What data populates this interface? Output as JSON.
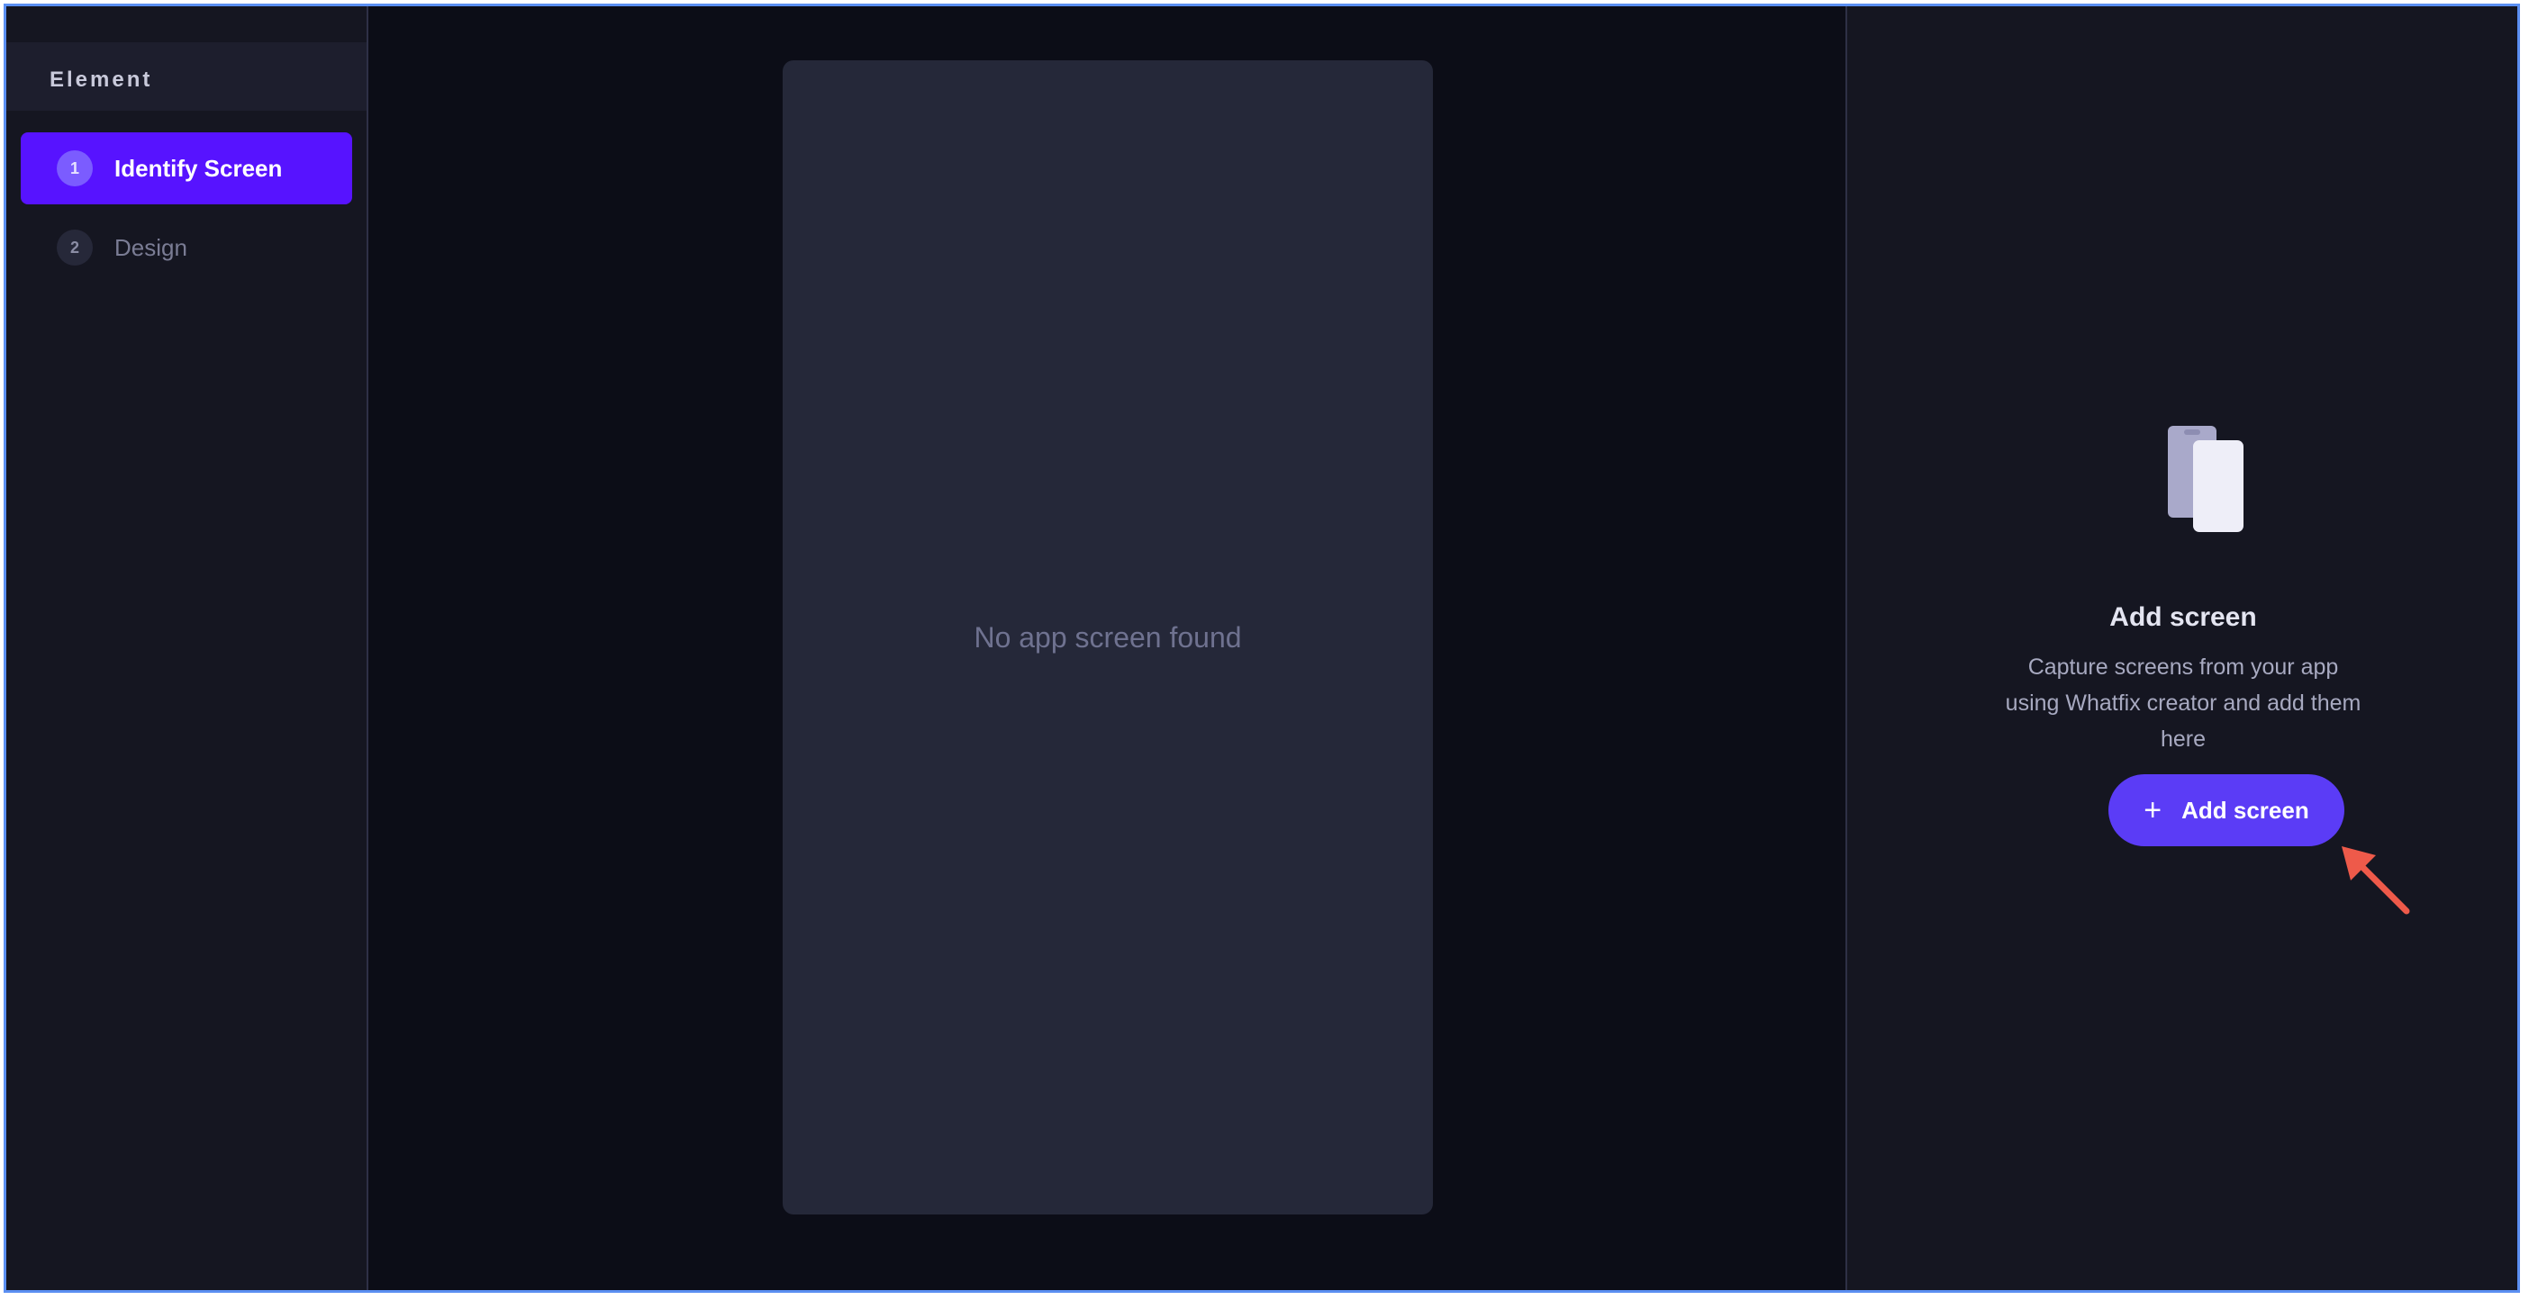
{
  "sidebar": {
    "title": "Element",
    "steps": [
      {
        "number": "1",
        "label": "Identify Screen",
        "active": true
      },
      {
        "number": "2",
        "label": "Design",
        "active": false
      }
    ]
  },
  "canvas": {
    "empty_message": "No app screen found"
  },
  "right_panel": {
    "icon": "mobile-screens-icon",
    "heading": "Add screen",
    "description": "Capture screens from your app using Whatfix creator and add them here",
    "button": {
      "icon": "plus-icon",
      "label": "Add screen"
    }
  },
  "colors": {
    "accent": "#5713ff",
    "button": "#5b3cf6",
    "annotation_arrow": "#ee5a4a"
  }
}
